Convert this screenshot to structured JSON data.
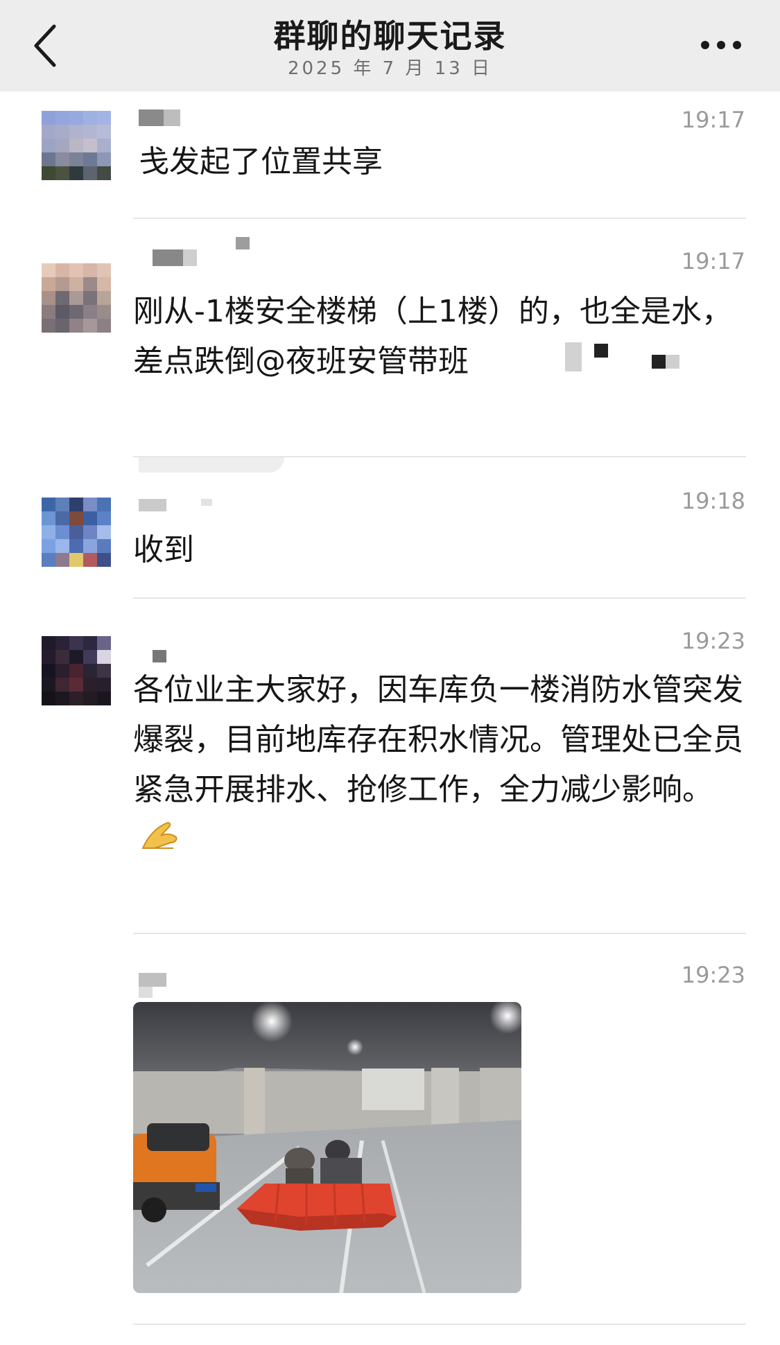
{
  "header": {
    "title": "群聊的聊天记录",
    "date": "2025 年 7 月 13 日",
    "back_icon": "chevron-left-icon",
    "more_icon": "more-icon"
  },
  "messages": [
    {
      "time": "19:17",
      "text": "戋发起了位置共享"
    },
    {
      "time": "19:17",
      "text": "刚从-1楼安全楼梯（上1楼）的，也全是水，差点跌倒@夜班安管带班"
    },
    {
      "time": "19:18",
      "text": "收到"
    },
    {
      "time": "19:23",
      "text": "各位业主大家好，因车库负一楼消防水管突发爆裂，目前地库存在积水情况。管理处已全员紧急开展排水、抢修工作，全力减少影响。",
      "emoji": "pray-hands-icon"
    },
    {
      "time": "19:23",
      "image": "parking-garage-flood-barrier-photo"
    }
  ],
  "colors": {
    "header_bg": "#ededed",
    "time": "#9a9a9a",
    "divider": "#e6e6e6"
  }
}
